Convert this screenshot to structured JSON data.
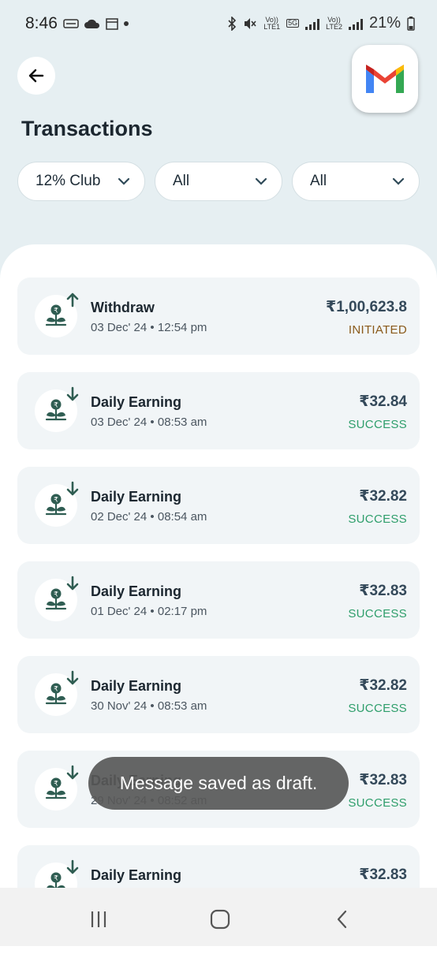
{
  "status_bar": {
    "time": "8:46",
    "battery": "21%",
    "sim1_top": "Vo))",
    "sim1_bottom": "LTE1",
    "sim2_top": "Vo))",
    "sim2_bottom": "LTE2",
    "network": "5G"
  },
  "header": {
    "title": "Transactions"
  },
  "filters": [
    {
      "label": "12% Club"
    },
    {
      "label": "All"
    },
    {
      "label": "All"
    }
  ],
  "transactions": [
    {
      "title": "Withdraw",
      "date": "03 Dec' 24",
      "time": "12:54 pm",
      "amount": "₹1,00,623.8",
      "status": "INITIATED",
      "direction": "up"
    },
    {
      "title": "Daily Earning",
      "date": "03 Dec' 24",
      "time": "08:53 am",
      "amount": "₹32.84",
      "status": "SUCCESS",
      "direction": "down"
    },
    {
      "title": "Daily Earning",
      "date": "02 Dec' 24",
      "time": "08:54 am",
      "amount": "₹32.82",
      "status": "SUCCESS",
      "direction": "down"
    },
    {
      "title": "Daily Earning",
      "date": "01 Dec' 24",
      "time": "02:17 pm",
      "amount": "₹32.83",
      "status": "SUCCESS",
      "direction": "down"
    },
    {
      "title": "Daily Earning",
      "date": "30 Nov' 24",
      "time": "08:53 am",
      "amount": "₹32.82",
      "status": "SUCCESS",
      "direction": "down"
    },
    {
      "title": "Daily Earning",
      "date": "29 Nov' 24",
      "time": "08:52 am",
      "amount": "₹32.83",
      "status": "SUCCESS",
      "direction": "down"
    },
    {
      "title": "Daily Earning",
      "date": "",
      "time": "",
      "amount": "₹32.83",
      "status": "",
      "direction": "down"
    }
  ],
  "separator": "•",
  "toast": {
    "message": "Message saved as draft."
  },
  "colors": {
    "background": "#e6eff2",
    "accent": "#2f5d52",
    "success": "#2e9e6b",
    "initiated": "#8a5a1a"
  },
  "icons": {
    "back": "arrow-left-icon",
    "filter_chevron": "chevron-down-icon",
    "transaction": "rupee-plant-icon",
    "gmail": "gmail-icon"
  }
}
